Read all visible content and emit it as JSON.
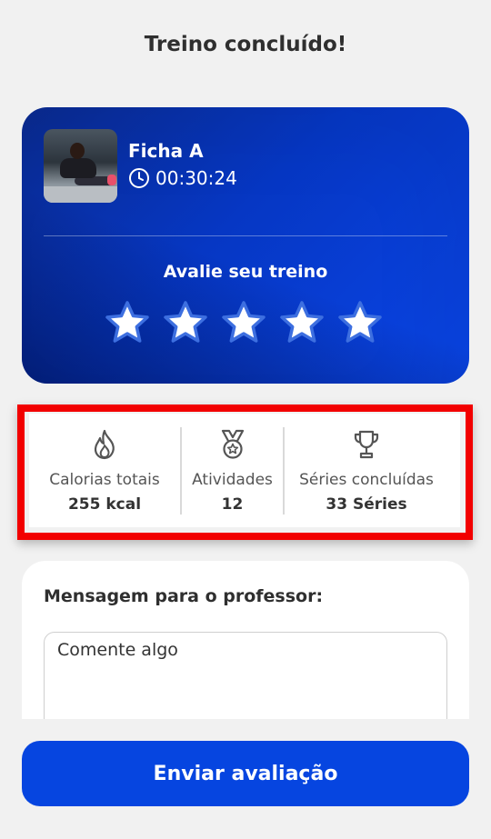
{
  "header": {
    "title": "Treino concluído!"
  },
  "summary": {
    "plan_name": "Ficha A",
    "duration": "00:30:24",
    "rate_label": "Avalie seu treino",
    "stars_total": 5,
    "stars_selected": 0
  },
  "stats": {
    "calories": {
      "label": "Calorias totais",
      "value": "255 kcal",
      "icon": "flame-icon"
    },
    "activities": {
      "label": "Atividades",
      "value": "12",
      "icon": "medal-icon"
    },
    "series": {
      "label": "Séries concluídas",
      "value": "33 Séries",
      "icon": "trophy-icon"
    }
  },
  "message": {
    "title": "Mensagem para o professor:",
    "placeholder": "Comente algo",
    "value": ""
  },
  "footer": {
    "submit_label": "Enviar avaliação"
  },
  "colors": {
    "primary": "#0645e0",
    "card_gradient_dark": "#0a2a8f",
    "highlight": "#f20000",
    "background": "#f1f1f1"
  }
}
